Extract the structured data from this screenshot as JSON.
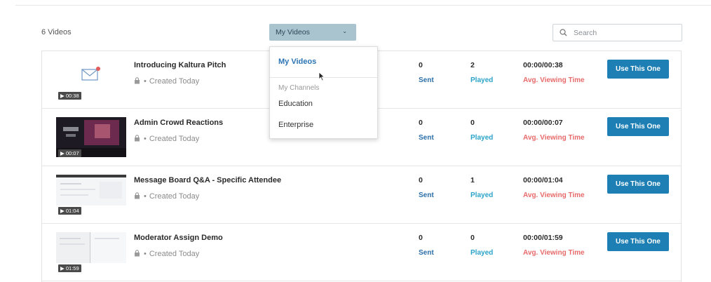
{
  "header": {
    "video_count": "6 Videos",
    "dropdown_label": "My Videos",
    "search_placeholder": "Search"
  },
  "dropdown_menu": {
    "selected": "My Videos",
    "section_header": "My Channels",
    "items": [
      "Education",
      "Enterprise"
    ]
  },
  "labels": {
    "sent": "Sent",
    "played": "Played",
    "avg_viewing_time": "Avg. Viewing Time",
    "use_button": "Use This One",
    "created": "Created Today",
    "dot": "•"
  },
  "videos": [
    {
      "title": "Introducing Kaltura Pitch",
      "duration": "00:38",
      "sent": "0",
      "played": "2",
      "viewing": "00:00/00:38",
      "thumb": "envelope-icon"
    },
    {
      "title": "Admin Crowd Reactions",
      "duration": "00:07",
      "sent": "0",
      "played": "0",
      "viewing": "00:00/00:07",
      "thumb": "dark-crowd"
    },
    {
      "title": "Message Board Q&A - Specific Attendee",
      "duration": "01:04",
      "sent": "0",
      "played": "1",
      "viewing": "00:00/01:04",
      "thumb": "screen-capture"
    },
    {
      "title": "Moderator Assign Demo",
      "duration": "01:59",
      "sent": "0",
      "played": "0",
      "viewing": "00:00/01:59",
      "thumb": "screen-capture"
    }
  ],
  "colors": {
    "accent_button": "#1d7fb4",
    "dropdown_bg": "#a9c3cf",
    "sent_label": "#2b6fa8",
    "played_label": "#2aa3c9",
    "avg_label": "#e86a6a"
  }
}
